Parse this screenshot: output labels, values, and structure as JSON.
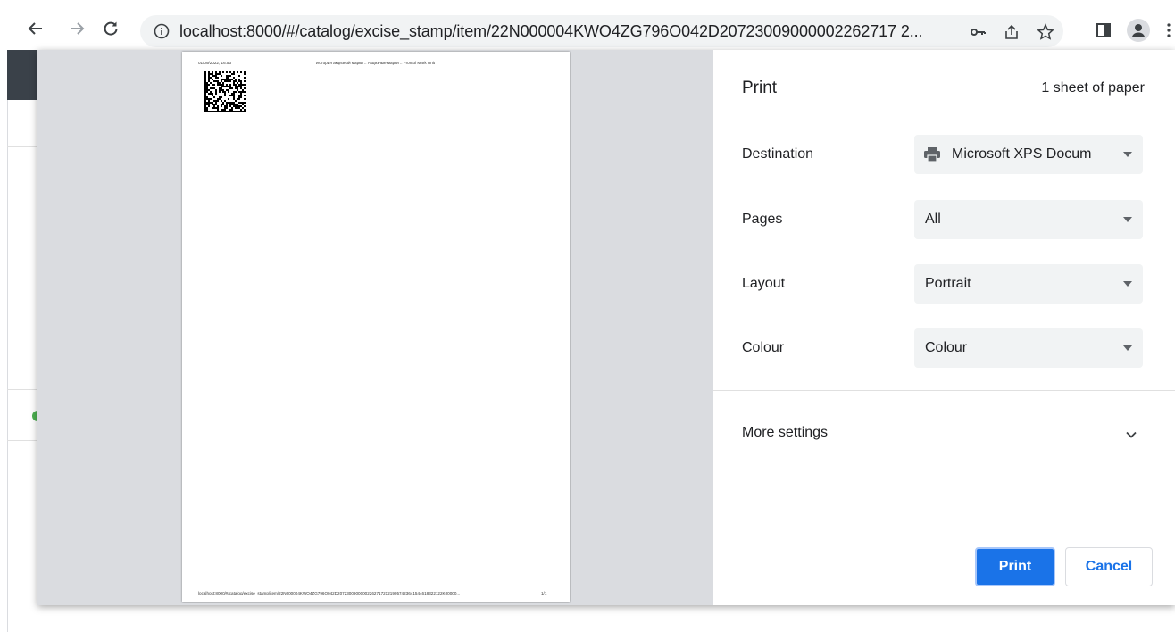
{
  "browser": {
    "url": "localhost:8000/#/catalog/excise_stamp/item/22N000004KWO4ZG796O042D20723009000002262717 2...",
    "icons": {
      "back": "back-arrow-icon",
      "forward": "forward-arrow-icon",
      "reload": "reload-icon",
      "info": "info-icon",
      "key": "key-icon",
      "share": "share-icon",
      "bookmark": "star-icon",
      "sidepanel": "side-panel-icon",
      "profile": "profile-icon"
    }
  },
  "preview": {
    "header_date": "01/09/2022, 16:53",
    "header_title": "История акцизной марки :: Акцизные марки :: Frontol Mark Unit",
    "footer_url": "localhost:8000/#/catalog/excise_stamp/item/22N000004KWO4ZG796O042D2072300900000226271721219057423641544618322122K00000...",
    "footer_page": "1/1"
  },
  "print": {
    "title": "Print",
    "sheet_count": "1 sheet of paper",
    "destination_label": "Destination",
    "destination_value": "Microsoft XPS Docum",
    "pages_label": "Pages",
    "pages_value": "All",
    "layout_label": "Layout",
    "layout_value": "Portrait",
    "colour_label": "Colour",
    "colour_value": "Colour",
    "more_settings": "More settings",
    "print_button": "Print",
    "cancel_button": "Cancel"
  },
  "colors": {
    "accent": "#1a73e8",
    "preview_bg": "#dadce0",
    "select_bg": "#f1f3f4"
  }
}
